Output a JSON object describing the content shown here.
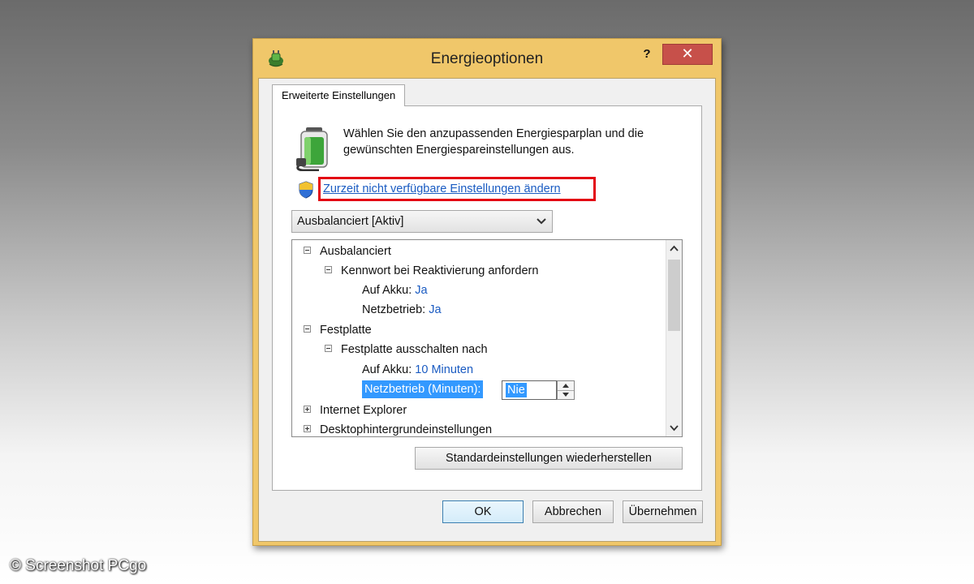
{
  "window": {
    "title": "Energieoptionen",
    "help_label": "?",
    "close_label": "✕"
  },
  "tab": {
    "label": "Erweiterte Einstellungen"
  },
  "intro": {
    "text": "Wählen Sie den anzupassenden Energiesparplan und die gewünschten Energiespareinstellungen aus."
  },
  "link": {
    "text": "Zurzeit nicht verfügbare Einstellungen ändern",
    "highlight_color": "#e30613"
  },
  "plan_select": {
    "value": "Ausbalanciert [Aktiv]"
  },
  "tree": {
    "ausbalanciert": "Ausbalanciert",
    "kennwort": "Kennwort bei Reaktivierung anfordern",
    "kennwort_akku_label": "Auf Akku:",
    "kennwort_akku_value": "Ja",
    "kennwort_netz_label": "Netzbetrieb:",
    "kennwort_netz_value": "Ja",
    "festplatte": "Festplatte",
    "festplatte_aus": "Festplatte ausschalten nach",
    "festplatte_akku_label": "Auf Akku:",
    "festplatte_akku_value": "10 Minuten",
    "festplatte_netz_label": "Netzbetrieb (Minuten):",
    "festplatte_netz_value": "Nie",
    "internet_explorer": "Internet Explorer",
    "desktop": "Desktophintergrundeinstellungen"
  },
  "buttons": {
    "restore": "Standardeinstellungen wiederherstellen",
    "ok": "OK",
    "cancel": "Abbrechen",
    "apply": "Übernehmen"
  },
  "watermark": "© Screenshot PCgo",
  "colors": {
    "link": "#1a5bc2",
    "selection": "#3399ff",
    "close": "#c7504a",
    "frame": "#f0c76a"
  }
}
